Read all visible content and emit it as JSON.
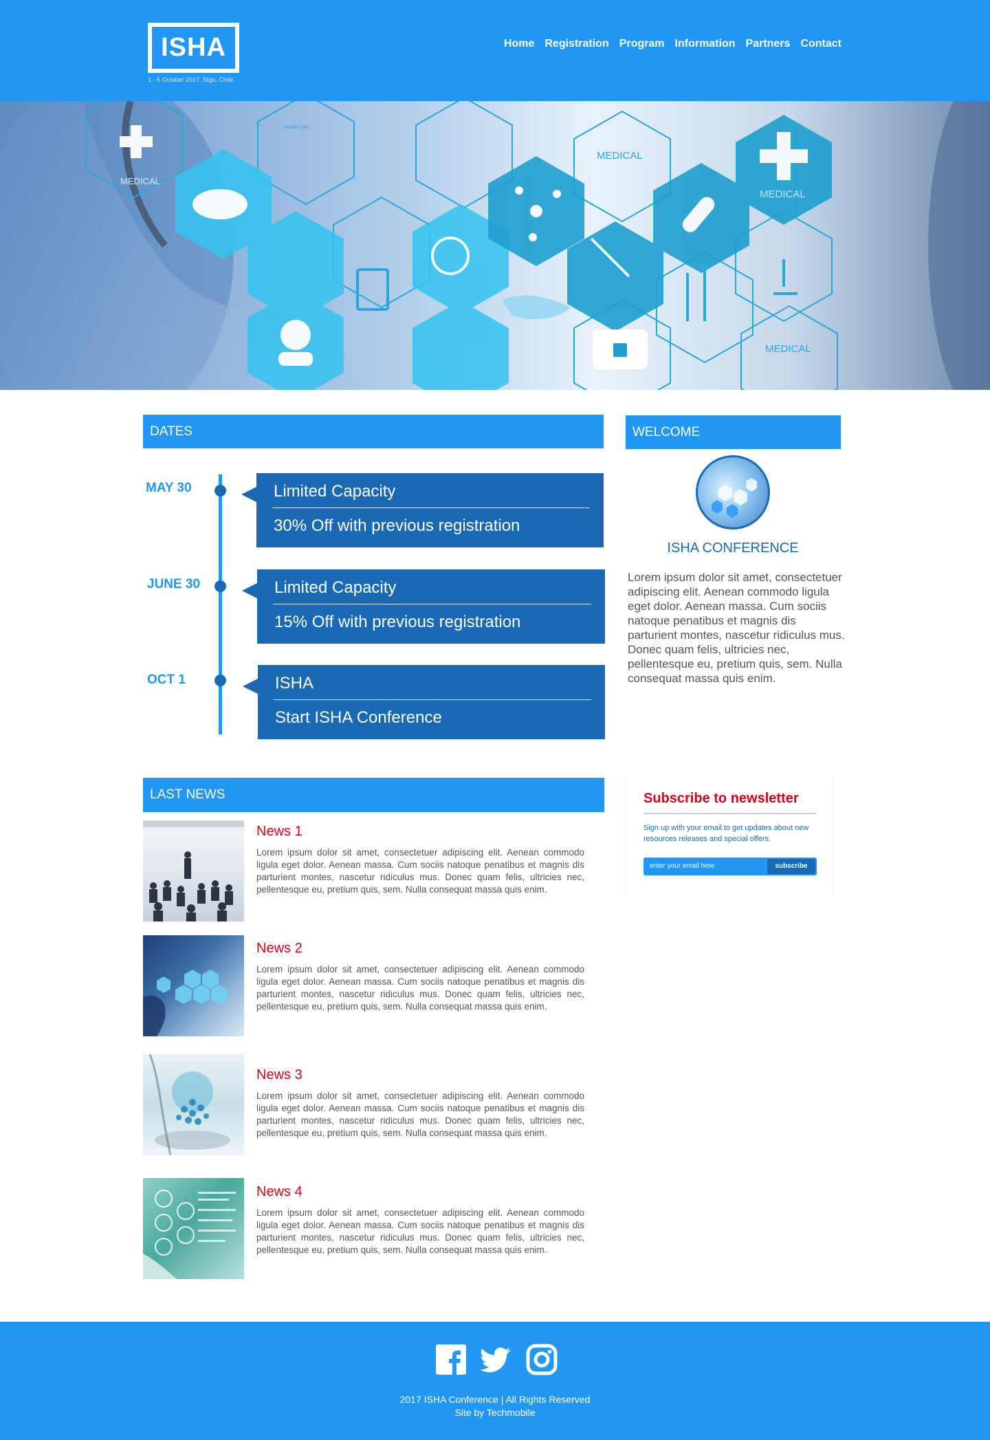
{
  "brand": {
    "logo": "ISHA",
    "subtitle": "1 - 5 October 2017, Stgo, Chile"
  },
  "nav": [
    "Home",
    "Registration",
    "Program",
    "Information",
    "Partners",
    "Contact"
  ],
  "hero": {
    "labels": [
      "MEDICAL",
      "MEDICAL",
      "MEDICAL",
      "MEDICAL",
      "Health Care"
    ]
  },
  "dates": {
    "heading": "DATES",
    "items": [
      {
        "date": "MAY 30",
        "title": "Limited Capacity",
        "subtitle": "30% Off with previous registration"
      },
      {
        "date": "JUNE 30",
        "title": "Limited Capacity",
        "subtitle": "15% Off with previous registration"
      },
      {
        "date": "OCT 1",
        "title": "ISHA",
        "subtitle": "Start ISHA Conference"
      }
    ]
  },
  "welcome": {
    "heading": "WELCOME",
    "title": "ISHA CONFERENCE",
    "text": "Lorem ipsum dolor sit amet, consectetuer adipiscing elit. Aenean commodo ligula eget dolor. Aenean massa. Cum sociis natoque penatibus et magnis dis parturient montes, nascetur ridiculus mus. Donec quam felis, ultricies nec, pellentesque eu, pretium quis, sem. Nulla consequat massa quis enim."
  },
  "news": {
    "heading": "LAST NEWS",
    "items": [
      {
        "title": "News 1",
        "text": "Lorem ipsum dolor sit amet, consectetuer adipiscing elit. Aenean commodo ligula eget dolor. Aenean massa. Cum sociis natoque penatibus et magnis dis parturient montes, nascetur ridiculus mus. Donec quam felis, ultricies nec, pellentesque eu, pretium quis, sem. Nulla consequat massa quis enim."
      },
      {
        "title": "News 2",
        "text": "Lorem ipsum dolor sit amet, consectetuer adipiscing elit. Aenean commodo ligula eget dolor. Aenean massa. Cum sociis natoque penatibus et magnis dis parturient montes, nascetur ridiculus mus. Donec quam felis, ultricies nec, pellentesque eu, pretium quis, sem. Nulla consequat massa quis enim."
      },
      {
        "title": "News 3",
        "text": "Lorem ipsum dolor sit amet, consectetuer adipiscing elit. Aenean commodo ligula eget dolor. Aenean massa. Cum sociis natoque penatibus et magnis dis parturient montes, nascetur ridiculus mus. Donec quam felis, ultricies nec, pellentesque eu, pretium quis, sem. Nulla consequat massa quis enim."
      },
      {
        "title": "News 4",
        "text": "Lorem ipsum dolor sit amet, consectetuer adipiscing elit. Aenean commodo ligula eget dolor. Aenean massa. Cum sociis natoque penatibus et magnis dis parturient montes, nascetur ridiculus mus. Donec quam felis, ultricies nec, pellentesque eu, pretium quis, sem. Nulla consequat massa quis enim."
      }
    ]
  },
  "newsletter": {
    "title": "Subscribe to newsletter",
    "description": "Sign up with your email to get updates about new resources releases and special offers.",
    "placeholder": "enter your email here",
    "button": "subscribe"
  },
  "footer": {
    "socials": [
      "facebook-icon",
      "twitter-icon",
      "instagram-icon"
    ],
    "copyright": "2017 ISHA Conference | All Rights Reserved",
    "credit": "Site by Techmobile"
  },
  "colors": {
    "primary": "#2196f3",
    "dark": "#1a69b5",
    "accent": "#d0021b",
    "text": "#555555"
  }
}
